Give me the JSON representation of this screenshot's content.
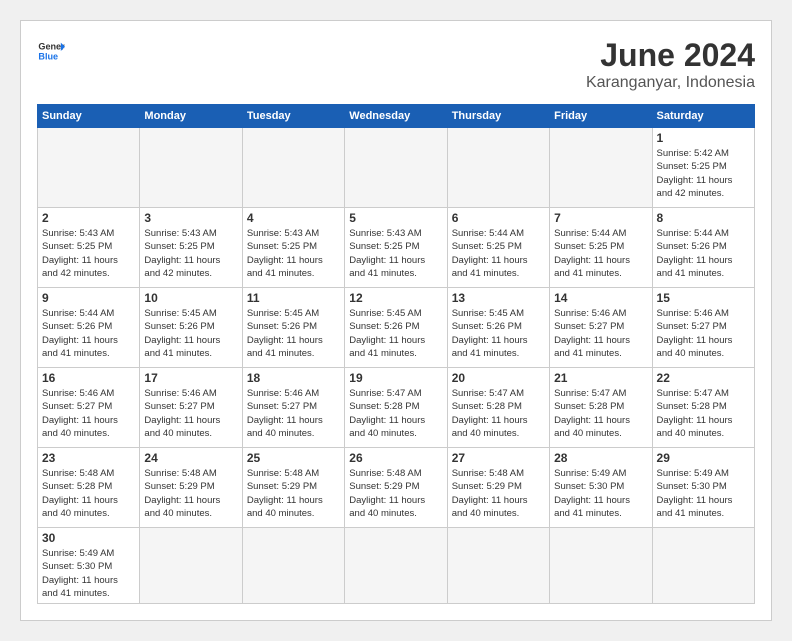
{
  "header": {
    "logo_general": "General",
    "logo_blue": "Blue",
    "month_title": "June 2024",
    "subtitle": "Karanganyar, Indonesia"
  },
  "weekdays": [
    "Sunday",
    "Monday",
    "Tuesday",
    "Wednesday",
    "Thursday",
    "Friday",
    "Saturday"
  ],
  "days": {
    "1": {
      "sunrise": "5:42 AM",
      "sunset": "5:25 PM",
      "daylight": "11 hours and 42 minutes."
    },
    "2": {
      "sunrise": "5:43 AM",
      "sunset": "5:25 PM",
      "daylight": "11 hours and 42 minutes."
    },
    "3": {
      "sunrise": "5:43 AM",
      "sunset": "5:25 PM",
      "daylight": "11 hours and 42 minutes."
    },
    "4": {
      "sunrise": "5:43 AM",
      "sunset": "5:25 PM",
      "daylight": "11 hours and 41 minutes."
    },
    "5": {
      "sunrise": "5:43 AM",
      "sunset": "5:25 PM",
      "daylight": "11 hours and 41 minutes."
    },
    "6": {
      "sunrise": "5:44 AM",
      "sunset": "5:25 PM",
      "daylight": "11 hours and 41 minutes."
    },
    "7": {
      "sunrise": "5:44 AM",
      "sunset": "5:25 PM",
      "daylight": "11 hours and 41 minutes."
    },
    "8": {
      "sunrise": "5:44 AM",
      "sunset": "5:26 PM",
      "daylight": "11 hours and 41 minutes."
    },
    "9": {
      "sunrise": "5:44 AM",
      "sunset": "5:26 PM",
      "daylight": "11 hours and 41 minutes."
    },
    "10": {
      "sunrise": "5:45 AM",
      "sunset": "5:26 PM",
      "daylight": "11 hours and 41 minutes."
    },
    "11": {
      "sunrise": "5:45 AM",
      "sunset": "5:26 PM",
      "daylight": "11 hours and 41 minutes."
    },
    "12": {
      "sunrise": "5:45 AM",
      "sunset": "5:26 PM",
      "daylight": "11 hours and 41 minutes."
    },
    "13": {
      "sunrise": "5:45 AM",
      "sunset": "5:26 PM",
      "daylight": "11 hours and 41 minutes."
    },
    "14": {
      "sunrise": "5:46 AM",
      "sunset": "5:27 PM",
      "daylight": "11 hours and 41 minutes."
    },
    "15": {
      "sunrise": "5:46 AM",
      "sunset": "5:27 PM",
      "daylight": "11 hours and 40 minutes."
    },
    "16": {
      "sunrise": "5:46 AM",
      "sunset": "5:27 PM",
      "daylight": "11 hours and 40 minutes."
    },
    "17": {
      "sunrise": "5:46 AM",
      "sunset": "5:27 PM",
      "daylight": "11 hours and 40 minutes."
    },
    "18": {
      "sunrise": "5:46 AM",
      "sunset": "5:27 PM",
      "daylight": "11 hours and 40 minutes."
    },
    "19": {
      "sunrise": "5:47 AM",
      "sunset": "5:28 PM",
      "daylight": "11 hours and 40 minutes."
    },
    "20": {
      "sunrise": "5:47 AM",
      "sunset": "5:28 PM",
      "daylight": "11 hours and 40 minutes."
    },
    "21": {
      "sunrise": "5:47 AM",
      "sunset": "5:28 PM",
      "daylight": "11 hours and 40 minutes."
    },
    "22": {
      "sunrise": "5:47 AM",
      "sunset": "5:28 PM",
      "daylight": "11 hours and 40 minutes."
    },
    "23": {
      "sunrise": "5:48 AM",
      "sunset": "5:28 PM",
      "daylight": "11 hours and 40 minutes."
    },
    "24": {
      "sunrise": "5:48 AM",
      "sunset": "5:29 PM",
      "daylight": "11 hours and 40 minutes."
    },
    "25": {
      "sunrise": "5:48 AM",
      "sunset": "5:29 PM",
      "daylight": "11 hours and 40 minutes."
    },
    "26": {
      "sunrise": "5:48 AM",
      "sunset": "5:29 PM",
      "daylight": "11 hours and 40 minutes."
    },
    "27": {
      "sunrise": "5:48 AM",
      "sunset": "5:29 PM",
      "daylight": "11 hours and 40 minutes."
    },
    "28": {
      "sunrise": "5:49 AM",
      "sunset": "5:30 PM",
      "daylight": "11 hours and 41 minutes."
    },
    "29": {
      "sunrise": "5:49 AM",
      "sunset": "5:30 PM",
      "daylight": "11 hours and 41 minutes."
    },
    "30": {
      "sunrise": "5:49 AM",
      "sunset": "5:30 PM",
      "daylight": "11 hours and 41 minutes."
    }
  },
  "labels": {
    "sunrise": "Sunrise:",
    "sunset": "Sunset:",
    "daylight": "Daylight:"
  }
}
